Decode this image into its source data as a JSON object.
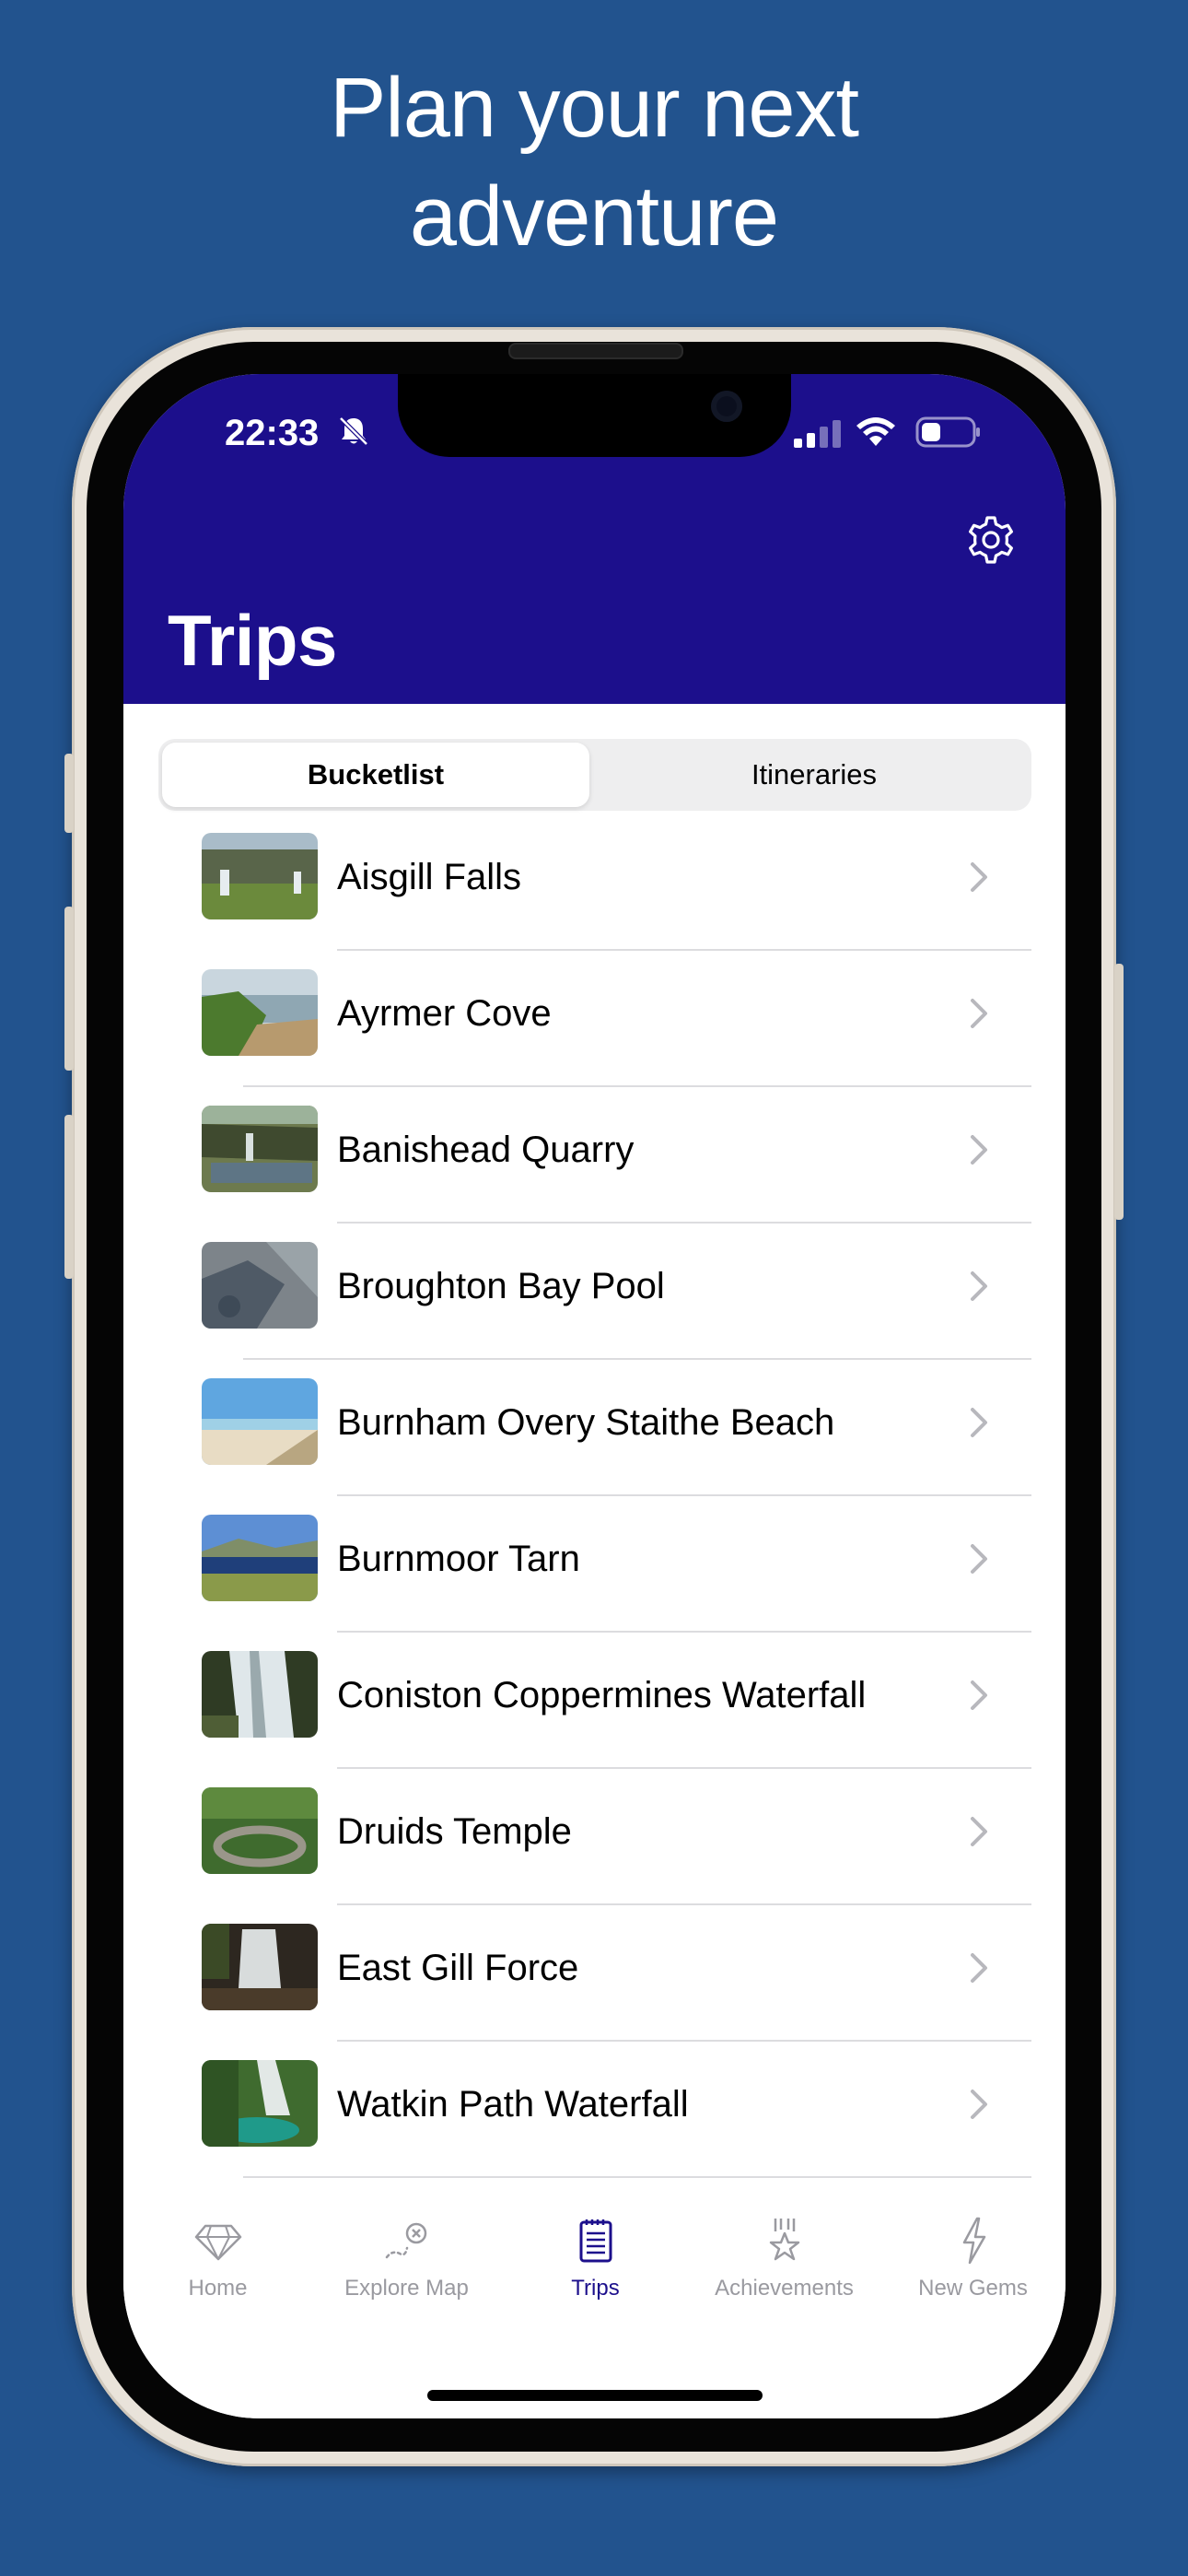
{
  "headline": {
    "line1": "Plan your next",
    "line2": "adventure"
  },
  "colors": {
    "background": "#22538e",
    "header": "#1c0f8c",
    "accent": "#1c0f8c"
  },
  "status_bar": {
    "time": "22:33",
    "icons": [
      "bell-slash-icon",
      "cellular-signal-icon",
      "wifi-icon",
      "battery-icon"
    ]
  },
  "header": {
    "title": "Trips",
    "settings_icon": "gear-icon"
  },
  "segmented_control": {
    "options": [
      "Bucketlist",
      "Itineraries"
    ],
    "selected": "Bucketlist"
  },
  "list": {
    "items": [
      {
        "label": "Aisgill Falls"
      },
      {
        "label": "Ayrmer Cove"
      },
      {
        "label": "Banishead Quarry"
      },
      {
        "label": "Broughton Bay Pool"
      },
      {
        "label": "Burnham Overy Staithe Beach"
      },
      {
        "label": "Burnmoor Tarn"
      },
      {
        "label": "Coniston Coppermines Waterfall"
      },
      {
        "label": "Druids Temple"
      },
      {
        "label": "East Gill Force"
      },
      {
        "label": "Watkin Path Waterfall"
      }
    ]
  },
  "tab_bar": {
    "tabs": [
      {
        "label": "Home",
        "icon": "gem-icon"
      },
      {
        "label": "Explore Map",
        "icon": "treasure-map-icon"
      },
      {
        "label": "Trips",
        "icon": "notepad-icon"
      },
      {
        "label": "Achievements",
        "icon": "medal-star-icon"
      },
      {
        "label": "New Gems",
        "icon": "lightning-icon"
      }
    ],
    "selected": "Trips"
  }
}
